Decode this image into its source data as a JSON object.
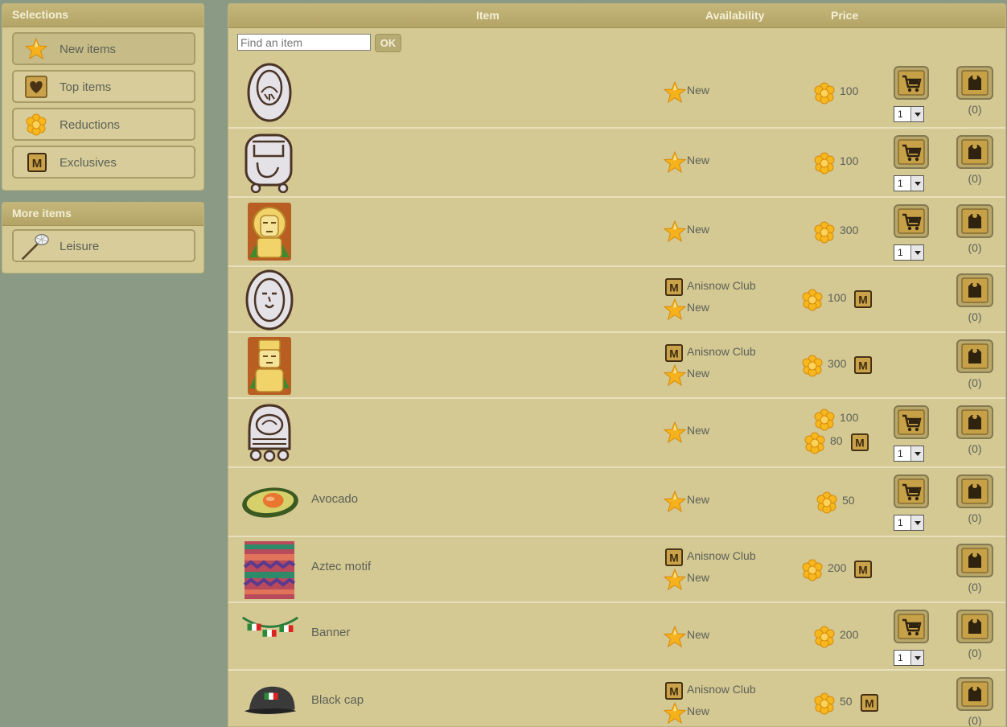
{
  "sidebar": {
    "selections_title": "Selections",
    "selections": [
      {
        "label": "New items",
        "icon": "star-icon"
      },
      {
        "label": "Top items",
        "icon": "heart-icon"
      },
      {
        "label": "Reductions",
        "icon": "flower-coin-icon"
      },
      {
        "label": "Exclusives",
        "icon": "m-badge-icon"
      }
    ],
    "more_title": "More items",
    "more": [
      {
        "label": "Leisure",
        "icon": "net-icon"
      }
    ]
  },
  "header": {
    "item": "Item",
    "availability": "Availability",
    "price": "Price"
  },
  "search": {
    "placeholder": "Find an item",
    "button": "OK"
  },
  "rows": [
    {
      "name": "",
      "avail": [
        "New"
      ],
      "price": "100",
      "member_price": "",
      "qty": "1",
      "count": "(0)",
      "thumb": "glyph-oval-icon"
    },
    {
      "name": "",
      "avail": [
        "New"
      ],
      "price": "100",
      "member_price": "",
      "qty": "1",
      "count": "(0)",
      "thumb": "glyph-square-icon"
    },
    {
      "name": "",
      "avail": [
        "New"
      ],
      "price": "300",
      "member_price": "",
      "qty": "1",
      "count": "(0)",
      "thumb": "golden-mask-icon"
    },
    {
      "name": "",
      "avail": [
        "Anisnow Club",
        "New"
      ],
      "price": "100",
      "member_price": "",
      "qty": "",
      "count": "(0)",
      "thumb": "glyph-face-icon"
    },
    {
      "name": "",
      "avail": [
        "Anisnow Club",
        "New"
      ],
      "price": "300",
      "member_price": "",
      "qty": "",
      "count": "(0)",
      "thumb": "golden-idol-icon"
    },
    {
      "name": "",
      "avail": [
        "New"
      ],
      "price": "100",
      "member_price": "80",
      "qty": "1",
      "count": "(0)",
      "thumb": "glyph-skull-icon"
    },
    {
      "name": "Avocado",
      "avail": [
        "New"
      ],
      "price": "50",
      "member_price": "",
      "qty": "1",
      "count": "(0)",
      "thumb": "avocado-icon"
    },
    {
      "name": "Aztec motif",
      "avail": [
        "Anisnow Club",
        "New"
      ],
      "price": "200",
      "member_price": "",
      "qty": "",
      "count": "(0)",
      "thumb": "aztec-motif-icon"
    },
    {
      "name": "Banner",
      "avail": [
        "New"
      ],
      "price": "200",
      "member_price": "",
      "qty": "1",
      "count": "(0)",
      "thumb": "banner-icon"
    },
    {
      "name": "Black cap",
      "avail": [
        "Anisnow Club",
        "New"
      ],
      "price": "50",
      "member_price": "",
      "qty": "",
      "count": "(0)",
      "thumb": "black-cap-icon"
    }
  ]
}
